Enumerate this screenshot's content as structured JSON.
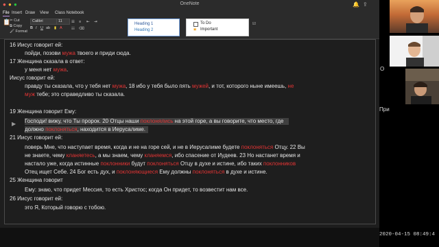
{
  "window": {
    "title": "OneNote"
  },
  "menu": {
    "items": [
      "File",
      "Insert",
      "Draw",
      "View",
      "Class Notebook"
    ]
  },
  "ribbon": {
    "clipboard": {
      "cut": "Cut",
      "copy": "Copy",
      "format": "Format"
    },
    "font": {
      "name": "Calibri",
      "size": "11"
    },
    "styles": {
      "heading1": "Heading 1",
      "heading2": "Heading 2"
    },
    "tags": {
      "todo": "To Do",
      "important": "Important"
    }
  },
  "notes": {
    "l1": [
      {
        "t": "16 Иисус говорит ей:"
      }
    ],
    "l2": [
      {
        "t": "пойди, позови "
      },
      {
        "t": "мужа",
        "r": 1
      },
      {
        "t": " твоего и приди сюда."
      }
    ],
    "l3": [
      {
        "t": "17 Женщина сказала в ответ:"
      }
    ],
    "l4": [
      {
        "t": "у меня нет "
      },
      {
        "t": "мужа",
        "r": 1
      },
      {
        "t": "."
      }
    ],
    "l5": [
      {
        "t": "Иисус говорит ей:"
      }
    ],
    "l6": [
      {
        "t": "правду ты сказала, что у тебя нет "
      },
      {
        "t": "мужа",
        "r": 1
      },
      {
        "t": ", 18 ибо у тебя было пять "
      },
      {
        "t": "мужей",
        "r": 1
      },
      {
        "t": ", и тот, которого ныне имеешь, "
      },
      {
        "t": "не",
        "r": 1
      }
    ],
    "l7": [
      {
        "t": "муж",
        "r": 1
      },
      {
        "t": " тебе; это справедливо ты сказала."
      }
    ],
    "l8": [
      {
        "t": "19 Женщина говорит Ему:"
      }
    ],
    "l9": [
      {
        "t": "Господи! вижу, что Ты пророк. 20 Отцы наши "
      },
      {
        "t": "поклонялись",
        "r": 1
      },
      {
        "t": " на этой горе, а вы говорите, что место, где"
      }
    ],
    "l10": [
      {
        "t": "должно "
      },
      {
        "t": "поклоняться",
        "r": 1
      },
      {
        "t": ", находится в Иерусалиме."
      }
    ],
    "l11": [
      {
        "t": "21 Иисус говорит ей:"
      }
    ],
    "l12": [
      {
        "t": "поверь Мне, что наступает время, когда и не на горе сей, и не в Иерусалиме будете "
      },
      {
        "t": "поклоняться",
        "r": 1
      },
      {
        "t": " Отцу. 22 Вы"
      }
    ],
    "l13": [
      {
        "t": "не знаете, чему "
      },
      {
        "t": "кланяетесь",
        "r": 1
      },
      {
        "t": ", а мы знаем, чему "
      },
      {
        "t": "кланяемся",
        "r": 1
      },
      {
        "t": ", ибо спасение от Иудеев. 23 Но настанет время и"
      }
    ],
    "l14": [
      {
        "t": "настало уже, когда истинные "
      },
      {
        "t": "поклонники",
        "r": 1
      },
      {
        "t": " будут "
      },
      {
        "t": "поклоняться",
        "r": 1
      },
      {
        "t": " Отцу в духе и истине, ибо таких "
      },
      {
        "t": "поклонников",
        "r": 1
      }
    ],
    "l15": [
      {
        "t": "Отец ищет Себе. 24 Бог есть дух, и "
      },
      {
        "t": "поклоняющиеся",
        "r": 1
      },
      {
        "t": " Ему должны "
      },
      {
        "t": "поклоняться",
        "r": 1
      },
      {
        "t": " в духе и истине."
      }
    ],
    "l16": [
      {
        "t": "25 Женщина говорит"
      }
    ],
    "l17": [
      {
        "t": "Ему: знаю, что придет Мессия, то есть Христос; когда Он придет, то возвестит нам все."
      }
    ],
    "l18": [
      {
        "t": "26 Иисус говорит ей:"
      }
    ],
    "l19": [
      {
        "t": "это Я, Который говорю с тобою."
      }
    ]
  },
  "side": {
    "letter": "О",
    "partial": "При"
  },
  "timestamp": "2020-04-15  08:49:4",
  "colors": {
    "highlight_word": "#e23434",
    "accent": "#b98ee0"
  }
}
